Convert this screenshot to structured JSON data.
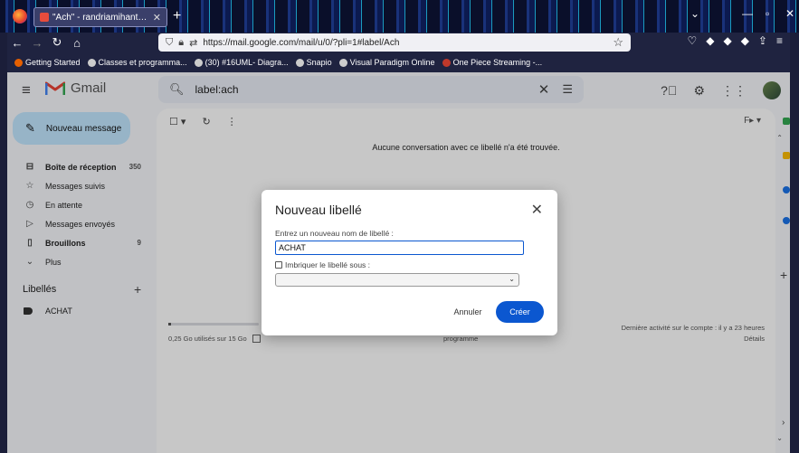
{
  "browser": {
    "tab_title": "\"Ach\" - randriamihantajudes@",
    "url": "https://mail.google.com/mail/u/0/?pli=1#label/Ach",
    "bookmarks": [
      "Getting Started",
      "Classes et programma...",
      "(30) #16UML- Diagra...",
      "Snapio",
      "Visual Paradigm Online",
      "One Piece Streaming -..."
    ]
  },
  "gmail": {
    "logo_text": "Gmail",
    "search_value": "label:ach",
    "compose_label": "Nouveau message",
    "nav": [
      {
        "label": "Boîte de réception",
        "count": "350",
        "icon": "inbox-icon",
        "bold": true
      },
      {
        "label": "Messages suivis",
        "count": "",
        "icon": "star-icon",
        "bold": false
      },
      {
        "label": "En attente",
        "count": "",
        "icon": "clock-icon",
        "bold": false
      },
      {
        "label": "Messages envoyés",
        "count": "",
        "icon": "send-icon",
        "bold": false
      },
      {
        "label": "Brouillons",
        "count": "9",
        "icon": "draft-icon",
        "bold": true
      },
      {
        "label": "Plus",
        "count": "",
        "icon": "chevron-down-icon",
        "bold": false
      }
    ],
    "labels_header": "Libellés",
    "labels": [
      "ACHAT"
    ],
    "empty_message": "Aucune conversation avec ce libellé n'a été trouvée.",
    "storage": "0,25 Go utilisés sur 15 Go",
    "footer_program": "programme",
    "activity": "Dernière activité sur le compte : il y a 23 heures",
    "details": "Détails"
  },
  "dialog": {
    "title": "Nouveau libellé",
    "name_label": "Entrez un nouveau nom de libellé :",
    "name_value": "ACHAT",
    "nest_label": "Imbriquer le libellé sous :",
    "cancel": "Annuler",
    "create": "Créer"
  },
  "colors": {
    "compose_bg": "#c2e7ff",
    "primary": "#0b57d0",
    "gmail_red": "#ea4335"
  }
}
